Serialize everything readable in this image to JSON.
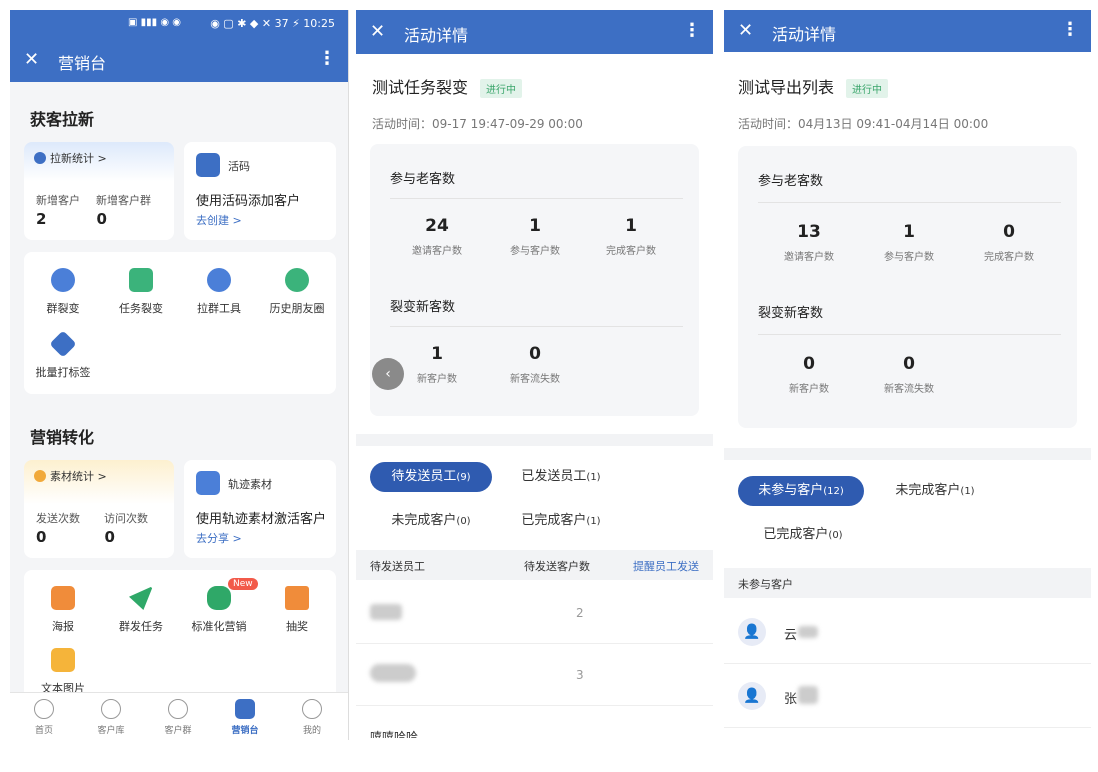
{
  "s1": {
    "time": "10:25",
    "battery": "37",
    "title": "营销台",
    "sec1": "获客拉新",
    "lx": {
      "title": "拉新统计 >",
      "l1": "新增客户",
      "l2": "新增客户群",
      "v1": "2",
      "v2": "0"
    },
    "hm": {
      "name": "活码",
      "desc": "使用活码添加客户",
      "link": "去创建 >"
    },
    "g1": [
      "群裂变",
      "任务裂变",
      "拉群工具",
      "历史朋友圈",
      "批量打标签"
    ],
    "sec2": "营销转化",
    "sc": {
      "title": "素材统计 >",
      "l1": "发送次数",
      "l2": "访问次数",
      "v1": "0",
      "v2": "0"
    },
    "gj": {
      "name": "轨迹素材",
      "desc": "使用轨迹素材激活客户",
      "link": "去分享 >"
    },
    "g2": [
      "海报",
      "群发任务",
      "标准化营销",
      "抽奖",
      "文本图片"
    ],
    "new_badge": "New",
    "tabs": [
      "首页",
      "客户库",
      "客户群",
      "营销台",
      "我的"
    ],
    "colors": {
      "brand": "#3d6fc4"
    }
  },
  "s2": {
    "title": "活动详情",
    "name": "测试任务裂变",
    "status": "进行中",
    "time": "活动时间：09-17 19:47-09-29 00:00",
    "p1": "参与老客数",
    "n1": [
      {
        "v": "24",
        "l": "邀请客户数"
      },
      {
        "v": "1",
        "l": "参与客户数"
      },
      {
        "v": "1",
        "l": "完成客户数"
      }
    ],
    "p2": "裂变新客数",
    "n2": [
      {
        "v": "1",
        "l": "新客户数"
      },
      {
        "v": "0",
        "l": "新客流失数"
      }
    ],
    "tabs": {
      "t1": "待发送员工",
      "c1": "(9)",
      "t2": "已发送员工",
      "c2": "(1)",
      "t3": "未完成客户",
      "c3": "(0)",
      "t4": "已完成客户",
      "c4": "(1)"
    },
    "th": {
      "h1": "待发送员工",
      "h2": "待发送客户数",
      "h3": "提醒员工发送"
    },
    "rows": [
      {
        "n": "2"
      },
      {
        "n": "3"
      },
      {
        "name": "嘻嘻哈哈"
      }
    ]
  },
  "s3": {
    "title": "活动详情",
    "name": "测试导出列表",
    "status": "进行中",
    "time": "活动时间：04月13日 09:41-04月14日 00:00",
    "p1": "参与老客数",
    "n1": [
      {
        "v": "13",
        "l": "邀请客户数"
      },
      {
        "v": "1",
        "l": "参与客户数"
      },
      {
        "v": "0",
        "l": "完成客户数"
      }
    ],
    "p2": "裂变新客数",
    "n2": [
      {
        "v": "0",
        "l": "新客户数"
      },
      {
        "v": "0",
        "l": "新客流失数"
      }
    ],
    "tabs": {
      "t1": "未参与客户",
      "c1": "(12)",
      "t2": "未完成客户",
      "c2": "(1)",
      "t3": "已完成客户",
      "c3": "(0)"
    },
    "th": "未参与客户",
    "rows": [
      {
        "n": "云"
      },
      {
        "n": "张"
      }
    ]
  }
}
